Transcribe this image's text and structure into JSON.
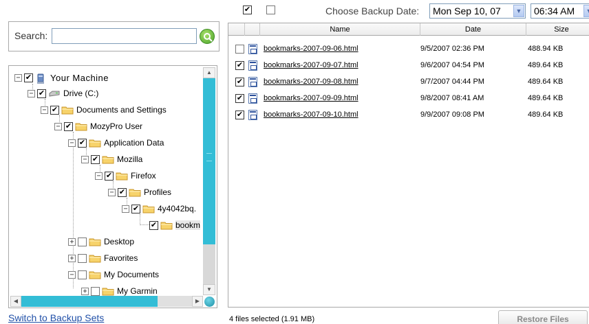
{
  "toolbar": {
    "select_all_checked": true,
    "select_none_checked": false,
    "backup_date_label": "Choose Backup Date:",
    "date_value": "Mon Sep 10, 07",
    "time_value": "06:34 AM"
  },
  "search": {
    "label": "Search:",
    "value": "",
    "placeholder": ""
  },
  "tree": {
    "items": [
      {
        "label": "Your Machine",
        "checked": true,
        "expander": "-",
        "icon": "computer-icon"
      },
      {
        "label": "Drive (C:)",
        "checked": true,
        "expander": "-",
        "icon": "drive-icon"
      },
      {
        "label": "Documents and Settings",
        "checked": true,
        "expander": "-",
        "icon": "folder-icon"
      },
      {
        "label": "MozyPro User",
        "checked": true,
        "expander": "-",
        "icon": "folder-icon"
      },
      {
        "label": "Application Data",
        "checked": true,
        "expander": "-",
        "icon": "folder-icon"
      },
      {
        "label": "Mozilla",
        "checked": true,
        "expander": "-",
        "icon": "folder-icon"
      },
      {
        "label": "Firefox",
        "checked": true,
        "expander": "-",
        "icon": "folder-icon"
      },
      {
        "label": "Profiles",
        "checked": true,
        "expander": "-",
        "icon": "folder-icon"
      },
      {
        "label": "4y4042bq.",
        "checked": true,
        "expander": "-",
        "icon": "folder-icon"
      },
      {
        "label": "bookm",
        "checked": true,
        "expander": "",
        "icon": "folder-icon"
      },
      {
        "label": "Desktop",
        "checked": false,
        "expander": "+",
        "icon": "folder-icon"
      },
      {
        "label": "Favorites",
        "checked": false,
        "expander": "+",
        "icon": "folder-icon"
      },
      {
        "label": "My Documents",
        "checked": false,
        "expander": "-",
        "icon": "folder-icon"
      },
      {
        "label": "My Garmin",
        "checked": false,
        "expander": "+",
        "icon": "folder-icon"
      }
    ]
  },
  "files": {
    "columns": [
      "Name",
      "Date",
      "Size"
    ],
    "rows": [
      {
        "name": "bookmarks-2007-09-06.html",
        "date": "9/5/2007 02:36 PM",
        "size": "488.94 KB",
        "checked": false
      },
      {
        "name": "bookmarks-2007-09-07.html",
        "date": "9/6/2007 04:54 PM",
        "size": "489.64 KB",
        "checked": true
      },
      {
        "name": "bookmarks-2007-09-08.html",
        "date": "9/7/2007 04:44 PM",
        "size": "489.64 KB",
        "checked": true
      },
      {
        "name": "bookmarks-2007-09-09.html",
        "date": "9/8/2007 08:41 AM",
        "size": "489.64 KB",
        "checked": true
      },
      {
        "name": "bookmarks-2007-09-10.html",
        "date": "9/9/2007 09:08 PM",
        "size": "489.64 KB",
        "checked": true
      }
    ]
  },
  "footer": {
    "switch_link": "Switch to Backup Sets",
    "status": "4 files selected (1.91 MB)",
    "restore_label": "Restore Files"
  },
  "colors": {
    "scrollbar": "#33bdd6",
    "link": "#2050a8",
    "search_button": "#4aa32a"
  }
}
